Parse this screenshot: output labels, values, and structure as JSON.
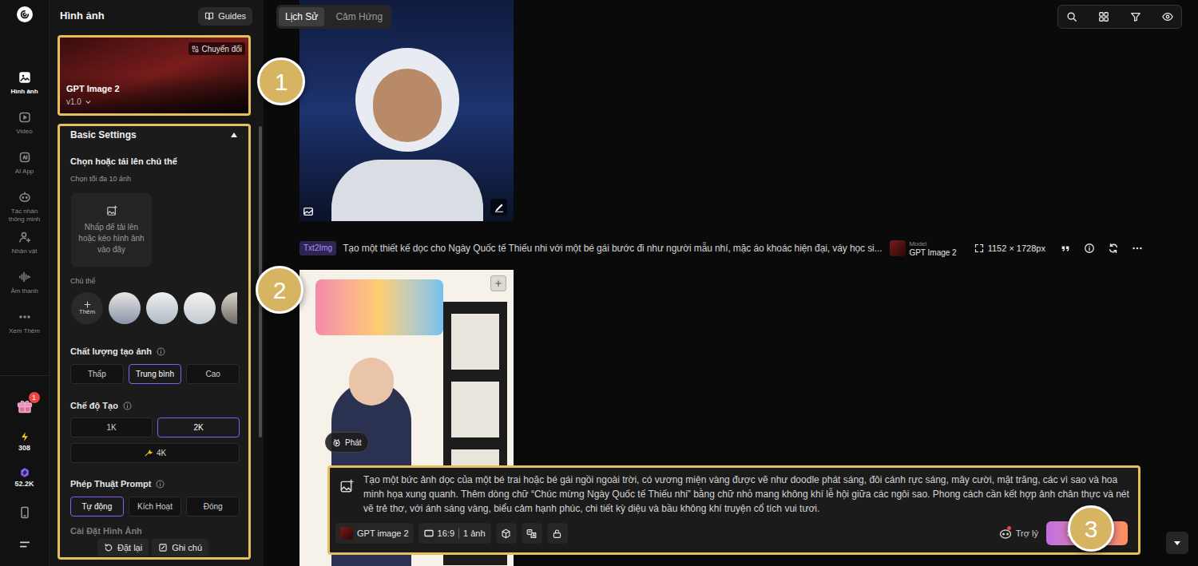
{
  "rail": {
    "items": [
      {
        "label": "Hình ảnh",
        "selected": true
      },
      {
        "label": "Video",
        "selected": false
      },
      {
        "label": "AI App",
        "selected": false
      },
      {
        "label": "Tác nhân thông minh",
        "selected": false
      },
      {
        "label": "Nhân vật",
        "selected": false
      },
      {
        "label": "Âm thanh",
        "selected": false
      },
      {
        "label": "Xem Thêm",
        "selected": false
      }
    ],
    "gift_badge": "1",
    "credits": [
      {
        "value": "308",
        "color": "#f5c518"
      },
      {
        "value": "52.2K",
        "color": "#8b5cf6"
      }
    ]
  },
  "panel": {
    "title": "Hình ảnh",
    "guides": "Guides",
    "model": {
      "name": "GPT Image 2",
      "version": "v1.0",
      "switch": "Chuyển đổi"
    },
    "basic": {
      "title": "Basic Settings",
      "expanded": true,
      "subject_title": "Chọn hoặc tải lên chủ thể",
      "subject_hint": "Chọn tối đa 10 ảnh",
      "upload": "Nhấp để tải lên hoặc kéo hình ảnh vào đây",
      "subject_label": "Chủ thể",
      "add": "Thêm",
      "groups": [
        {
          "label": "Chất lượng tạo ảnh",
          "options": [
            {
              "label": "Thấp",
              "selected": false
            },
            {
              "label": "Trung bình",
              "selected": true
            },
            {
              "label": "Cao",
              "selected": false
            }
          ]
        },
        {
          "label": "Chế độ Tạo",
          "options": [
            {
              "label": "1K",
              "selected": false
            },
            {
              "label": "2K",
              "selected": true
            },
            {
              "label": "4K",
              "selected": false
            }
          ]
        },
        {
          "label": "Phép Thuật Prompt",
          "options": [
            {
              "label": "Tự động",
              "selected": true
            },
            {
              "label": "Kích Hoạt",
              "selected": false
            },
            {
              "label": "Đóng",
              "selected": false
            }
          ]
        }
      ],
      "next_section": "Cài Đặt Hình Ảnh"
    },
    "footer": [
      "Đặt lại",
      "Ghi chú"
    ]
  },
  "main": {
    "tabs": [
      {
        "label": "Lịch Sử",
        "selected": true
      },
      {
        "label": "Cảm Hứng",
        "selected": false
      }
    ],
    "record": {
      "tag": "Txt2Img",
      "prompt": "Tạo một thiết kế dọc cho Ngày Quốc tế Thiếu nhi với một bé gái bước đi như người mẫu nhí, mặc áo khoác hiện đại, váy học si...",
      "model_label": "Model",
      "model_name": "GPT Image 2",
      "size": "1152 × 1728px"
    },
    "play": "Phát",
    "composer": {
      "prompt": "Tạo một bức ảnh dọc của một bé trai hoặc bé gái ngồi ngoài trời, có vương miện vàng được vẽ như doodle phát sáng, đôi cánh rực sáng, mây cười, mặt trăng, các vì sao và hoa minh họa xung quanh. Thêm dòng chữ “Chúc mừng Ngày Quốc tế Thiếu nhi” bằng chữ nhỏ mang không khí lễ hội giữa các ngôi sao. Phong cách cần kết hợp ảnh chân thực và nét vẽ trẻ thơ, với ánh sáng vàng, biểu cảm hạnh phúc, chi tiết kỳ diệu và bầu không khí truyện cổ tích vui tươi.",
      "model": "GPT image 2",
      "ratio": "16:9",
      "count": "1 ảnh",
      "assistant": "Trợ lý",
      "assistant_notice": true,
      "submit": "Sáng tạo"
    }
  },
  "markers": [
    "1",
    "2",
    "3"
  ]
}
